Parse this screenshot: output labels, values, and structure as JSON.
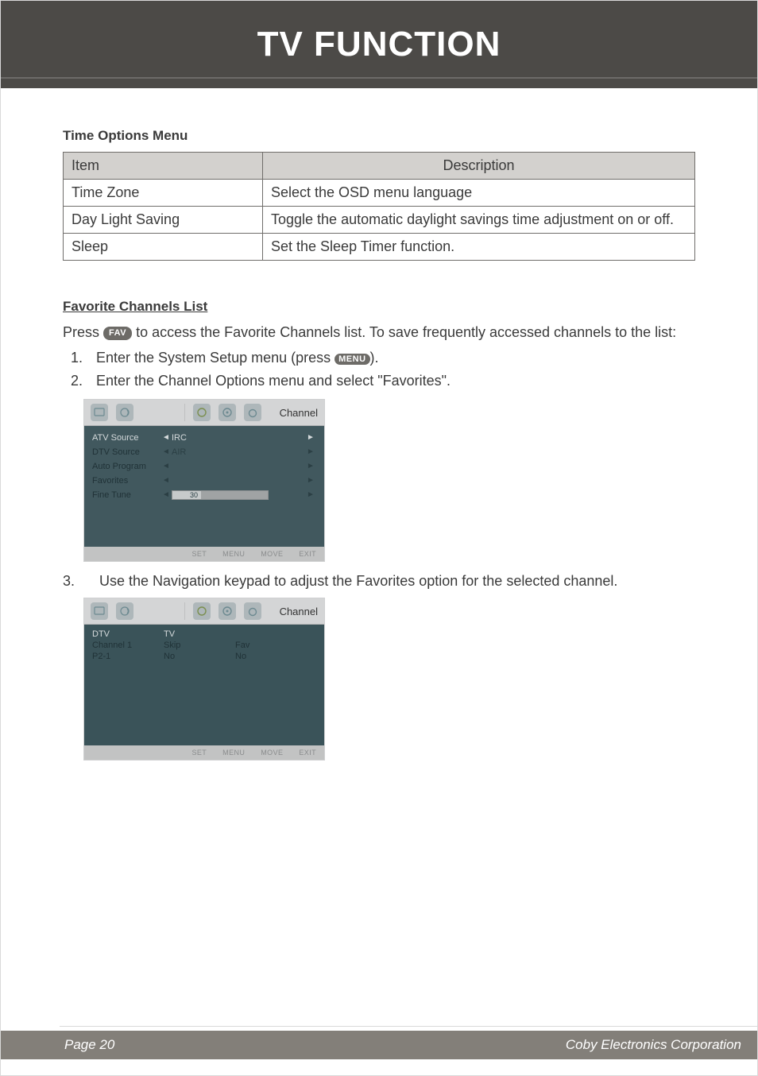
{
  "header": {
    "title": "TV FUNCTION"
  },
  "section1": {
    "heading": "Time Options Menu",
    "table": {
      "head_item": "Item",
      "head_desc": "Description",
      "rows": [
        {
          "item": "Time Zone",
          "desc": "Select the OSD menu language"
        },
        {
          "item": "Day Light Saving",
          "desc": "Toggle the automatic daylight savings time adjustment on or off."
        },
        {
          "item": "Sleep",
          "desc": "Set the Sleep Timer function."
        }
      ]
    }
  },
  "section2": {
    "heading": "Favorite Channels List",
    "press_prefix": "Press ",
    "fav_button": "FAV",
    "press_suffix": " to access the Favorite Channels list. To save frequently accessed channels to the list:",
    "steps12": [
      {
        "before": "Enter the System Setup menu (press ",
        "btn": "MENU",
        "after": ")."
      },
      {
        "text": "Enter the Channel Options menu and select \"Favorites\"."
      }
    ],
    "step3_num": "3.",
    "step3_text": "Use the Navigation keypad to adjust the Favorites option for the selected channel."
  },
  "osd1": {
    "tab_title": "Channel",
    "rows": [
      {
        "label": "ATV Source",
        "value": "IRC",
        "hl": true
      },
      {
        "label": "DTV Source",
        "value": "AIR"
      },
      {
        "label": "Auto Program",
        "value": ""
      },
      {
        "label": "Favorites",
        "value": ""
      },
      {
        "label": "Fine Tune",
        "slider": true,
        "slider_value": "30",
        "fill_pct": 30
      }
    ],
    "footer": [
      "SET",
      "MENU",
      "MOVE",
      "EXIT"
    ]
  },
  "osd2": {
    "tab_title": "Channel",
    "grid": {
      "r1c1": "DTV",
      "r1c2": "TV",
      "r1c3": "",
      "r2c1": "Channel 1",
      "r2c2": "Skip",
      "r2c3": "Fav",
      "r3c1": "P2-1",
      "r3c2": "No",
      "r3c3": "No"
    },
    "footer": [
      "SET",
      "MENU",
      "MOVE",
      "EXIT"
    ]
  },
  "footer": {
    "page": "Page 20",
    "company": "Coby Electronics Corporation"
  }
}
